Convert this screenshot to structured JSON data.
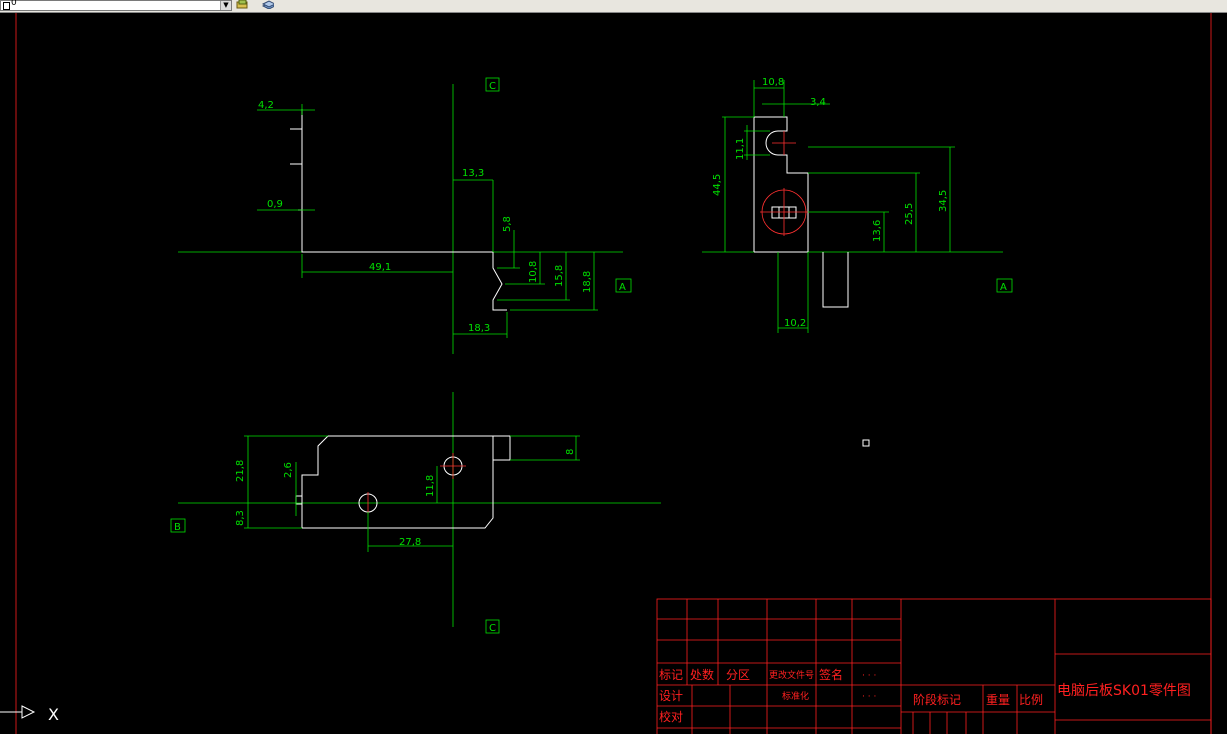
{
  "toolbar": {
    "layer_value": "0"
  },
  "colors": {
    "background": "#000000",
    "frame": "#ff2020",
    "geometry": "#ffffff",
    "dimension": "#00e000",
    "center": "#ff3030"
  },
  "dims": {
    "d4_2": "4,2",
    "d0_9": "0,9",
    "d13_3": "13,3",
    "d5_8": "5,8",
    "d49_1": "49,1",
    "d10_8a": "10,8",
    "d15_8": "15,8",
    "d18_8": "18,8",
    "d18_3": "18,3",
    "d10_8b": "10,8",
    "d3_4": "3,4",
    "d11_1": "11,1",
    "d44_5": "44,5",
    "d13_6": "13,6",
    "d25_5": "25,5",
    "d34_5": "34,5",
    "d10_2": "10,2",
    "d21_8": "21,8",
    "d2_6": "2,6",
    "d8": "8",
    "d11_8": "11,8",
    "d8_3": "8,3",
    "d27_8": "27,8"
  },
  "section_labels": {
    "c_top": "C",
    "c_bottom": "C",
    "a_left": "A",
    "a_right": "A",
    "b": "B"
  },
  "title_block": {
    "biaoji": "标记",
    "chushu": "处数",
    "fenqu": "分区",
    "genggai": "更改文件号",
    "qianming": "签名",
    "sheji": "设计",
    "biaozhunhua": "标准化",
    "jiaodui": "校对",
    "jieduan": "阶段标记",
    "zhongliang": "重量",
    "bili": "比例",
    "title": "电脑后板SK01零件图",
    "dots1": "·  ·  ·",
    "dots2": "·  ·  ·"
  },
  "ucs": {
    "x_label": "X"
  }
}
